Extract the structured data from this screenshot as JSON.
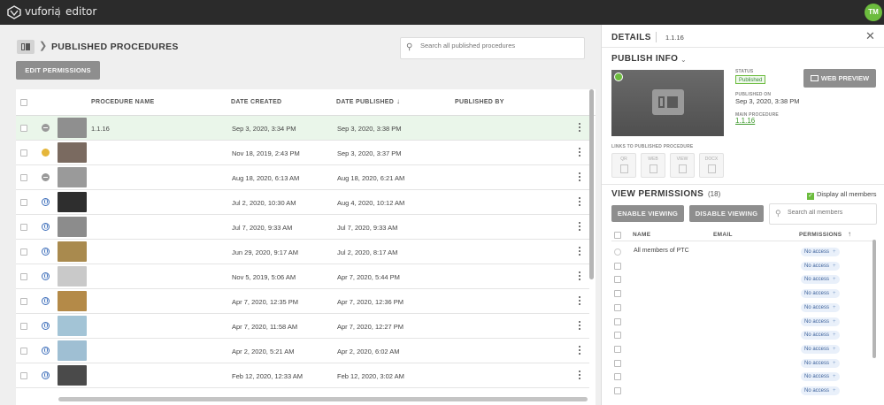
{
  "topbar": {
    "brand": "vuforia",
    "app": "editor",
    "user_initials": "TM"
  },
  "left": {
    "title": "PUBLISHED PROCEDURES",
    "search_placeholder": "Search all published procedures",
    "edit_permissions_label": "EDIT PERMISSIONS",
    "columns": {
      "name": "PROCEDURE NAME",
      "created": "DATE CREATED",
      "published": "DATE PUBLISHED",
      "published_by": "PUBLISHED BY",
      "sort_icon": "arrow-down-icon"
    },
    "rows": [
      {
        "status": "minus",
        "thumb": "#8f8f8f",
        "name": "1.1.16",
        "created": "Sep 3, 2020, 3:34 PM",
        "published": "Sep 3, 2020, 3:38 PM",
        "selected": true
      },
      {
        "status": "face",
        "thumb": "#7a6a60",
        "name": "",
        "created": "Nov 18, 2019, 2:43 PM",
        "published": "Sep 3, 2020, 3:37 PM",
        "selected": false
      },
      {
        "status": "minus",
        "thumb": "#9a9a9a",
        "name": "",
        "created": "Aug 18, 2020, 6:13 AM",
        "published": "Aug 18, 2020, 6:21 AM",
        "selected": false
      },
      {
        "status": "globe",
        "thumb": "#2e2e2e",
        "name": "",
        "created": "Jul 2, 2020, 10:30 AM",
        "published": "Aug 4, 2020, 10:12 AM",
        "selected": false
      },
      {
        "status": "globe",
        "thumb": "#8c8c8c",
        "name": "",
        "created": "Jul 7, 2020, 9:33 AM",
        "published": "Jul 7, 2020, 9:33 AM",
        "selected": false
      },
      {
        "status": "globe",
        "thumb": "#a98a4e",
        "name": "",
        "created": "Jun 29, 2020, 9:17 AM",
        "published": "Jul 2, 2020, 8:17 AM",
        "selected": false
      },
      {
        "status": "globe",
        "thumb": "#c9c9c9",
        "name": "",
        "created": "Nov 5, 2019, 5:06 AM",
        "published": "Apr 7, 2020, 5:44 PM",
        "selected": false
      },
      {
        "status": "globe",
        "thumb": "#b48a48",
        "name": "",
        "created": "Apr 7, 2020, 12:35 PM",
        "published": "Apr 7, 2020, 12:36 PM",
        "selected": false
      },
      {
        "status": "globe",
        "thumb": "#a3c4d6",
        "name": "",
        "created": "Apr 7, 2020, 11:58 AM",
        "published": "Apr 7, 2020, 12:27 PM",
        "selected": false
      },
      {
        "status": "globe",
        "thumb": "#9fbfd3",
        "name": "",
        "created": "Apr 2, 2020, 5:21 AM",
        "published": "Apr 2, 2020, 6:02 AM",
        "selected": false
      },
      {
        "status": "globe",
        "thumb": "#4a4a4a",
        "name": "",
        "created": "Feb 12, 2020, 12:33 AM",
        "published": "Feb 12, 2020, 3:02 AM",
        "selected": false
      }
    ]
  },
  "details": {
    "title": "DETAILS",
    "name": "1.1.16",
    "publish_info_title": "PUBLISH INFO",
    "status_label": "STATUS",
    "status_value": "Published",
    "published_on_label": "PUBLISHED ON",
    "published_on_value": "Sep 3, 2020, 3:38 PM",
    "main_procedure_label": "MAIN PROCEDURE",
    "main_procedure_value": "1.1.16",
    "web_preview_label": "WEB PREVIEW",
    "links_label": "LINKS TO PUBLISHED PROCEDURE",
    "link_tiles": [
      "QR",
      "WEB",
      "VIEW",
      "DOCX"
    ],
    "view_permissions_title": "VIEW PERMISSIONS",
    "view_permissions_count": "(18)",
    "display_all_label": "Display all members",
    "enable_viewing_label": "ENABLE VIEWING",
    "disable_viewing_label": "DISABLE VIEWING",
    "member_search_placeholder": "Search all members",
    "member_columns": {
      "name": "NAME",
      "email": "EMAIL",
      "permissions": "PERMISSIONS"
    },
    "members": [
      {
        "name": "All members of PTC",
        "access": "No access",
        "group": true
      },
      {
        "name": "",
        "access": "No access",
        "group": false
      },
      {
        "name": "",
        "access": "No access",
        "group": false
      },
      {
        "name": "",
        "access": "No access",
        "group": false
      },
      {
        "name": "",
        "access": "No access",
        "group": false
      },
      {
        "name": "",
        "access": "No access",
        "group": false
      },
      {
        "name": "",
        "access": "No access",
        "group": false
      },
      {
        "name": "",
        "access": "No access",
        "group": false
      },
      {
        "name": "",
        "access": "No access",
        "group": false
      },
      {
        "name": "",
        "access": "No access",
        "group": false
      },
      {
        "name": "",
        "access": "No access",
        "group": false
      }
    ]
  },
  "colors": {
    "accent_green": "#6cbc3e",
    "topbar": "#2b2b2b",
    "button_grey": "#8e8e8e",
    "selected_row": "#eaf6ea"
  }
}
